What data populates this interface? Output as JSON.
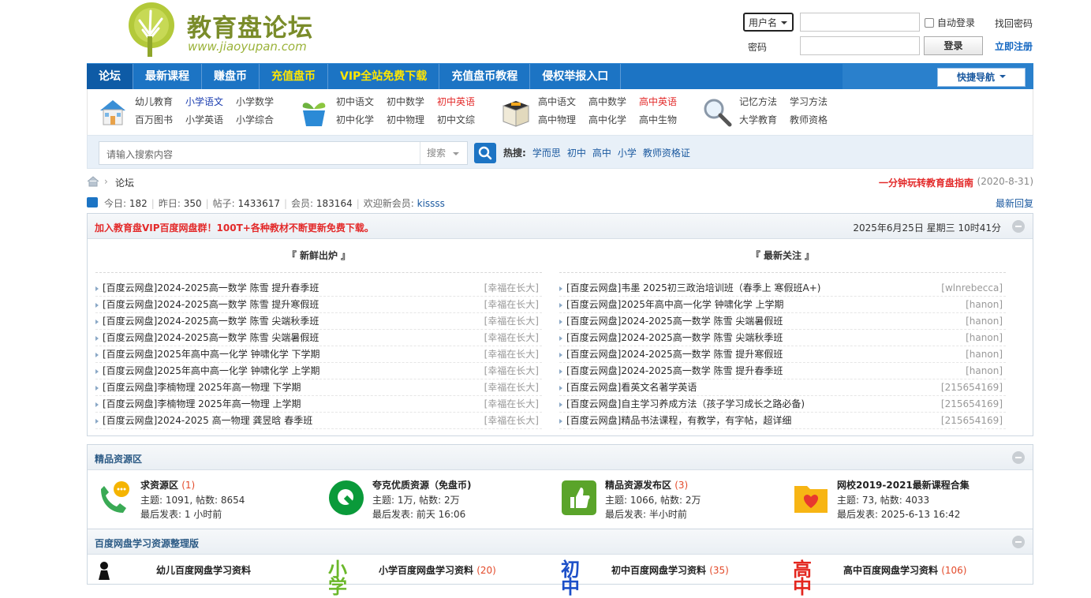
{
  "logo": {
    "title": "教育盘论坛",
    "url": "www.jiaoyupan.com"
  },
  "login": {
    "user_type": "用户名",
    "password_label": "密码",
    "username_value": "",
    "password_value": "",
    "auto_login": "自动登录",
    "login_button": "登录",
    "find_password": "找回密码",
    "register": "立即注册"
  },
  "nav": {
    "items": [
      "论坛",
      "最新课程",
      "赚盘币",
      "充值盘币",
      "VIP全站免费下载",
      "充值盘币教程",
      "侵权举报入口"
    ],
    "quick_nav": "快捷导航"
  },
  "categories": [
    {
      "icon": "school-house-icon",
      "links": [
        "幼儿教育",
        "小学语文",
        "小学数学",
        "百万图书",
        "小学英语",
        "小学综合"
      ]
    },
    {
      "icon": "plant-pot-icon",
      "links": [
        "初中语文",
        "初中数学",
        "初中英语",
        "初中化学",
        "初中物理",
        "初中文综"
      ]
    },
    {
      "icon": "open-box-icon",
      "links": [
        "高中语文",
        "高中数学",
        "高中英语",
        "高中物理",
        "高中化学",
        "高中生物"
      ]
    },
    {
      "icon": "magnifier-icon",
      "links": [
        "记忆方法",
        "学习方法",
        "大学教育",
        "教师资格"
      ]
    }
  ],
  "search": {
    "placeholder": "请输入搜索内容",
    "type": "搜索",
    "hot_label": "热搜:",
    "hot": [
      "学而思",
      "初中",
      "高中",
      "小学",
      "教师资格证"
    ]
  },
  "breadcrumb": {
    "current": "论坛",
    "notice": "一分钟玩转教育盘指南",
    "notice_date": "(2020-8-31)"
  },
  "stats": {
    "today_label": "今日:",
    "today": "182",
    "yesterday_label": "昨日:",
    "yesterday": "350",
    "posts_label": "帖子:",
    "posts": "1433617",
    "members_label": "会员:",
    "members": "183164",
    "welcome_label": "欢迎新会员:",
    "new_member": "kissss",
    "latest": "最新回复"
  },
  "announce": {
    "title": "加入教育盘VIP百度网盘群！100T+各种教材不断更新免费下载。",
    "datetime": "2025年6月25日 星期三 10时41分"
  },
  "fresh": {
    "header": "『 新鲜出炉 』",
    "rows": [
      {
        "title": "[百度云网盘]2024-2025高一数学 陈雪 提升春季班",
        "user": "[幸福在长大]"
      },
      {
        "title": "[百度云网盘]2024-2025高一数学 陈雪 提升寒假班",
        "user": "[幸福在长大]"
      },
      {
        "title": "[百度云网盘]2024-2025高一数学 陈雪 尖端秋季班",
        "user": "[幸福在长大]"
      },
      {
        "title": "[百度云网盘]2024-2025高一数学 陈雪 尖端暑假班",
        "user": "[幸福在长大]"
      },
      {
        "title": "[百度云网盘]2025年高中高一化学 钟啸化学 下学期",
        "user": "[幸福在长大]"
      },
      {
        "title": "[百度云网盘]2025年高中高一化学 钟啸化学 上学期",
        "user": "[幸福在长大]"
      },
      {
        "title": "[百度云网盘]李楠物理 2025年高一物理 下学期",
        "user": "[幸福在长大]"
      },
      {
        "title": "[百度云网盘]李楠物理 2025年高一物理 上学期",
        "user": "[幸福在长大]"
      },
      {
        "title": "[百度云网盘]2024-2025 高一物理 龚昱晗 春季班",
        "user": "[幸福在长大]"
      }
    ]
  },
  "focus": {
    "header": "『 最新关注 』",
    "rows": [
      {
        "title": "[百度云网盘]韦墨 2025初三政治培训班（春季上 寒假班A+)",
        "user": "[wlnrebecca]"
      },
      {
        "title": "[百度云网盘]2025年高中高一化学 钟啸化学 上学期",
        "user": "[hanon]"
      },
      {
        "title": "[百度云网盘]2024-2025高一数学 陈雪 尖端暑假班",
        "user": "[hanon]"
      },
      {
        "title": "[百度云网盘]2024-2025高一数学 陈雪 尖端秋季班",
        "user": "[hanon]"
      },
      {
        "title": "[百度云网盘]2024-2025高一数学 陈雪 提升寒假班",
        "user": "[hanon]"
      },
      {
        "title": "[百度云网盘]2024-2025高一数学 陈雪 提升春季班",
        "user": "[hanon]"
      },
      {
        "title": "[百度云网盘]看英文名著学英语",
        "user": "[215654169]"
      },
      {
        "title": "[百度云网盘]自主学习养成方法（孩子学习成长之路必备)",
        "user": "[215654169]"
      },
      {
        "title": "[百度云网盘]精品书法课程，有教学，有字帖，超详细",
        "user": "[215654169]"
      }
    ]
  },
  "featured": {
    "title": "精品资源区",
    "items": [
      {
        "icon": "phone-chat-icon",
        "name": "求资源区",
        "count": "(1)",
        "meta": "主题: 1091, 帖数: 8654",
        "last": "最后发表: 1 小时前"
      },
      {
        "icon": "quark-logo-icon",
        "name": "夸克优质资源（免盘币)",
        "count": "",
        "meta": "主题: 1万, 帖数: 2万",
        "last": "最后发表: 前天 16:06"
      },
      {
        "icon": "thumbs-up-icon",
        "name": "精品资源发布区",
        "count": "(3)",
        "meta": "主题: 1066, 帖数: 2万",
        "last": "最后发表: 半小时前"
      },
      {
        "icon": "folder-heart-icon",
        "name": "网校2019-2021最新课程合集",
        "count": "",
        "meta": "主题: 73, 帖数: 4033",
        "last": "最后发表: 2025-6-13 16:42"
      }
    ]
  },
  "baidu": {
    "title": "百度网盘学习资源整理版",
    "items": [
      {
        "icon": "child-icon",
        "glyph": "",
        "name": "幼儿百度网盘学习资料",
        "count": ""
      },
      {
        "icon": "primary-school-icon",
        "glyph": "小学",
        "name": "小学百度网盘学习资料",
        "count": "(20)"
      },
      {
        "icon": "junior-high-icon",
        "glyph": "初中",
        "name": "初中百度网盘学习资料",
        "count": "(35)"
      },
      {
        "icon": "senior-high-icon",
        "glyph": "高中",
        "name": "高中百度网盘学习资料",
        "count": "(106)"
      }
    ]
  },
  "colors": {
    "nav": "#1c74c4",
    "accent_red": "#e32a2a",
    "link": "#1c5aa0",
    "nav_yellow": "#ffe600"
  }
}
